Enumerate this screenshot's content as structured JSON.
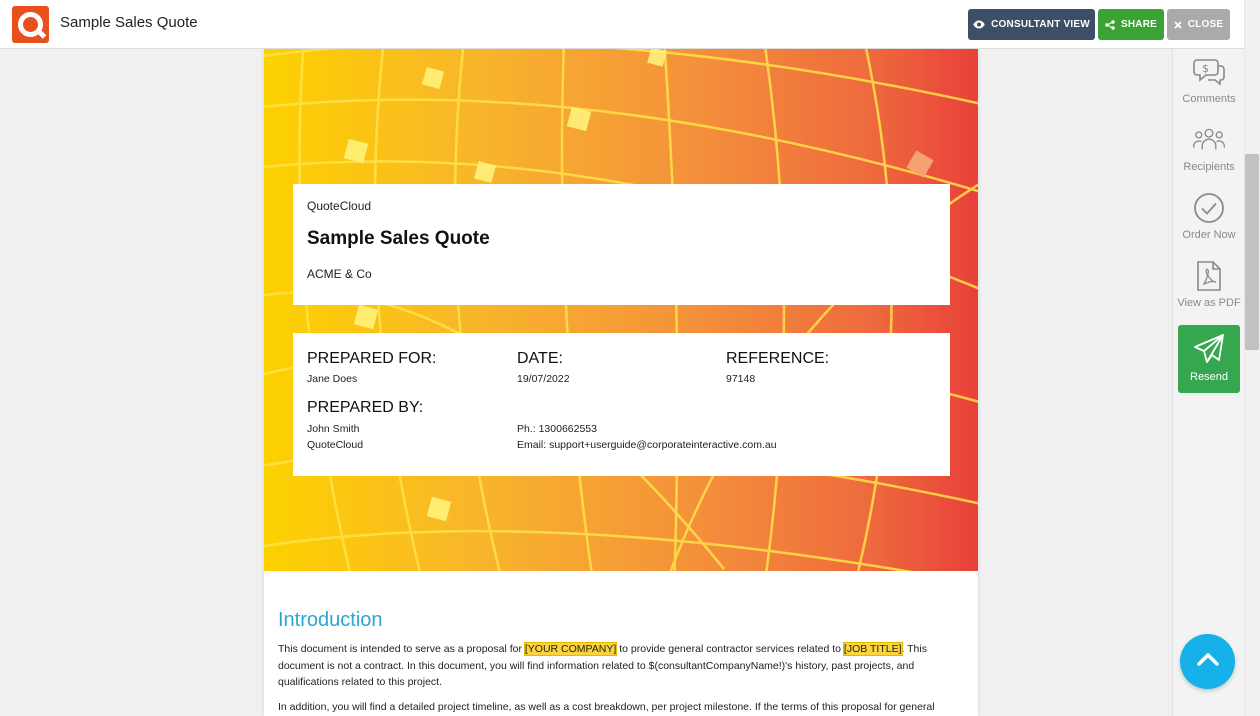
{
  "header": {
    "title": "Sample Sales Quote",
    "buttons": {
      "consultant_view": "CONSULTANT VIEW",
      "share": "SHARE",
      "close": "CLOSE"
    }
  },
  "sidebar": {
    "items": [
      {
        "label": "Comments",
        "icon": "comments-dollar-icon"
      },
      {
        "label": "Recipients",
        "icon": "people-icon"
      },
      {
        "label": "Order Now",
        "icon": "check-circle-icon"
      },
      {
        "label": "View as PDF",
        "icon": "pdf-file-icon"
      },
      {
        "label": "Resend",
        "icon": "paper-plane-icon"
      }
    ]
  },
  "document": {
    "brand": "QuoteCloud",
    "title": "Sample Sales Quote",
    "company": "ACME & Co",
    "prepared_for": {
      "heading": "PREPARED FOR:",
      "value": "Jane Does"
    },
    "date": {
      "heading": "DATE:",
      "value": "19/07/2022"
    },
    "reference": {
      "heading": "REFERENCE:",
      "value": "97148"
    },
    "prepared_by": {
      "heading": "PREPARED BY:",
      "name": "John Smith",
      "company": "QuoteCloud",
      "phone": "Ph.: 1300662553",
      "email": "Email: support+userguide@corporateinteractive.com.au"
    },
    "intro": {
      "heading": "Introduction",
      "p1_a": "This document is intended to serve as a proposal for ",
      "p1_hl1": "[YOUR COMPANY]",
      "p1_b": " to provide general contractor services related to ",
      "p1_hl2": "[JOB TITLE]",
      "p1_c": ". This document is not a contract. In this document, you will find information related to $(consultantCompanyName!)'s history, past projects, and qualifications related to this project.",
      "p2": "In addition, you will find a detailed project timeline, as well as a cost breakdown, per project milestone. If the terms of this proposal for general"
    }
  },
  "colors": {
    "accent_blue": "#2aa6d6",
    "consultant_btn": "#3d4f66",
    "share_btn": "#3aa334",
    "close_btn": "#a8aaac",
    "resend_btn": "#35a84f",
    "fab": "#16b1e8"
  }
}
